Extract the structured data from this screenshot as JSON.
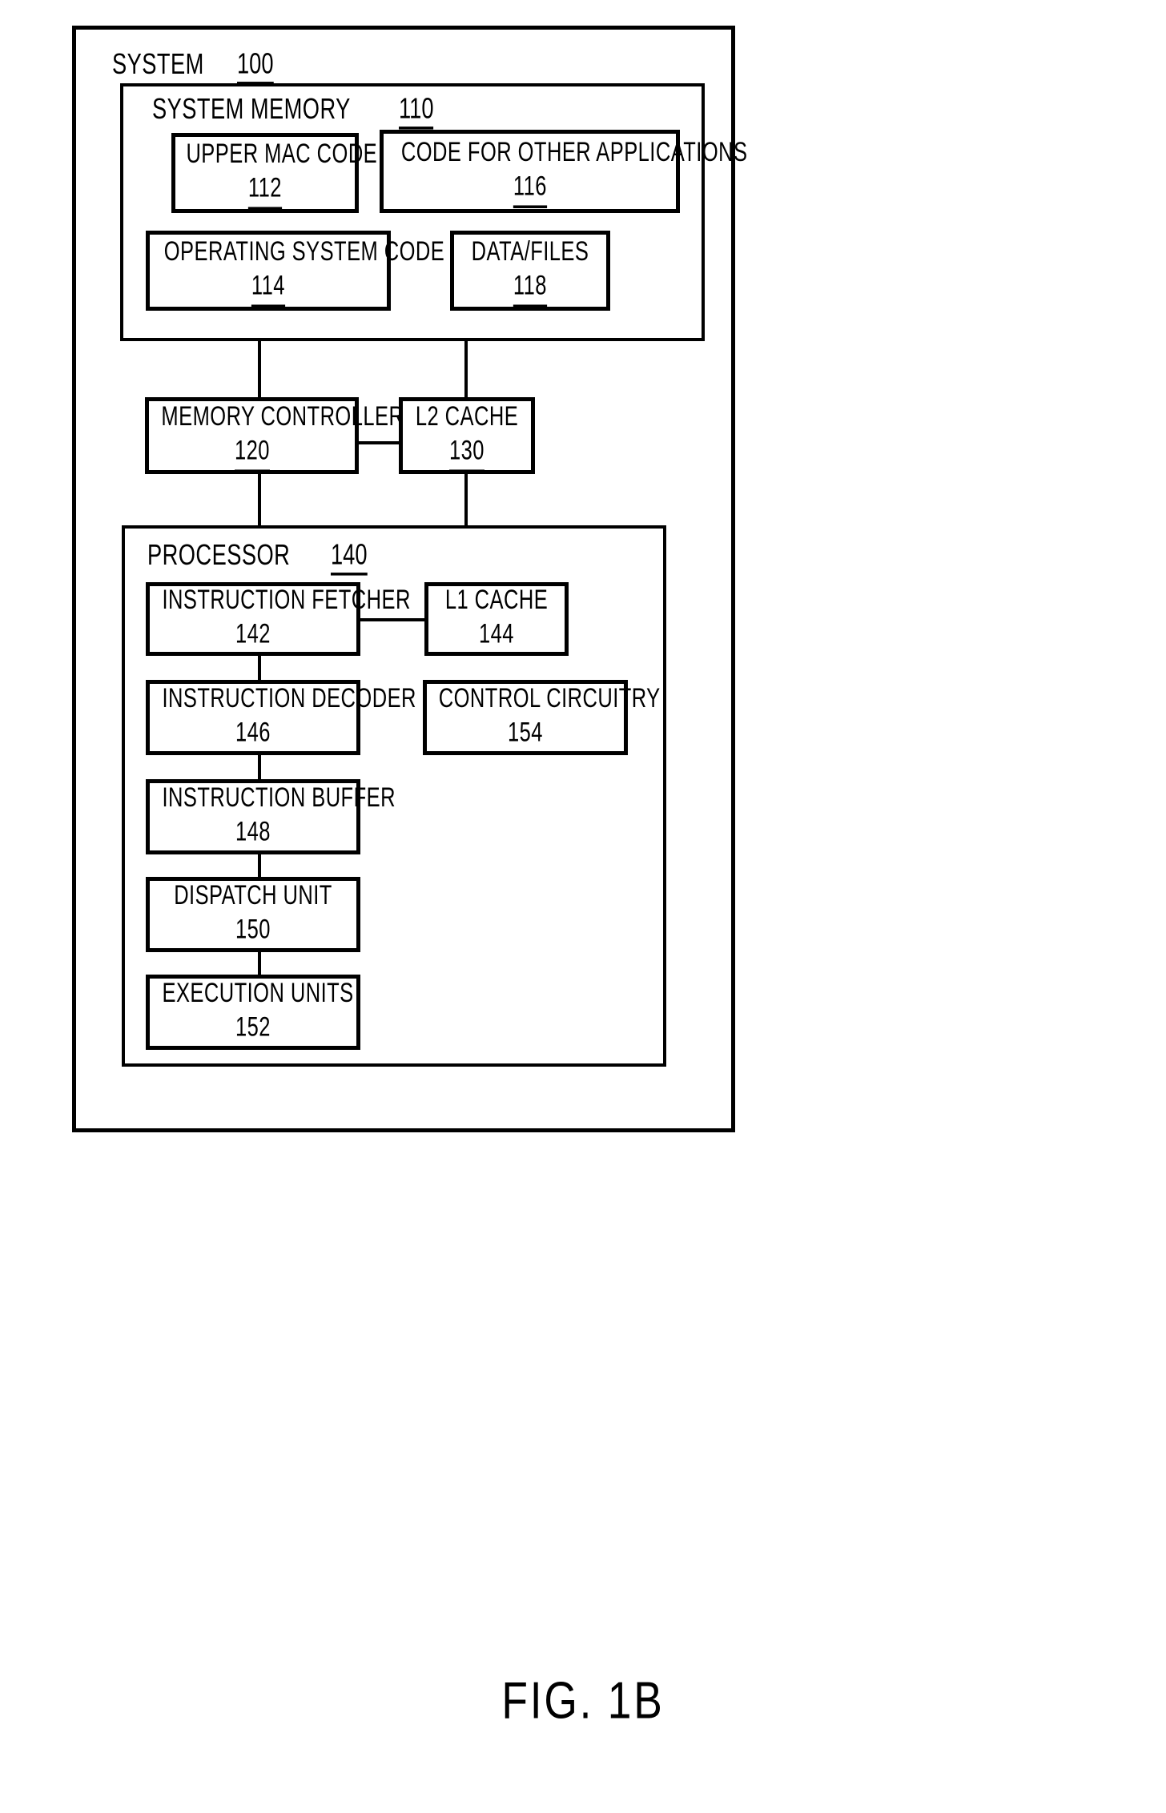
{
  "figure": {
    "caption": "FIG. 1B"
  },
  "system": {
    "label": "SYSTEM",
    "ref": "100"
  },
  "system_memory": {
    "label": "SYSTEM MEMORY",
    "ref": "110",
    "blocks": [
      {
        "label": "UPPER MAC CODE",
        "ref": "112"
      },
      {
        "label": "CODE FOR OTHER APPLICATIONS",
        "ref": "116"
      },
      {
        "label": "OPERATING SYSTEM CODE",
        "ref": "114"
      },
      {
        "label": "DATA/FILES",
        "ref": "118"
      }
    ]
  },
  "midlevel": {
    "blocks": [
      {
        "label": "MEMORY CONTROLLER",
        "ref": "120"
      },
      {
        "label": "L2 CACHE",
        "ref": "130"
      }
    ]
  },
  "processor": {
    "label": "PROCESSOR",
    "ref": "140",
    "blocks": [
      {
        "label": "INSTRUCTION FETCHER",
        "ref": "142"
      },
      {
        "label": "L1 CACHE",
        "ref": "144"
      },
      {
        "label": "INSTRUCTION DECODER",
        "ref": "146"
      },
      {
        "label": "CONTROL CIRCUITRY",
        "ref": "154"
      },
      {
        "label": "INSTRUCTION BUFFER",
        "ref": "148"
      },
      {
        "label": "DISPATCH UNIT",
        "ref": "150"
      },
      {
        "label": "EXECUTION UNITS",
        "ref": "152"
      }
    ]
  },
  "colors": {
    "line": "#000000",
    "background": "#ffffff"
  }
}
